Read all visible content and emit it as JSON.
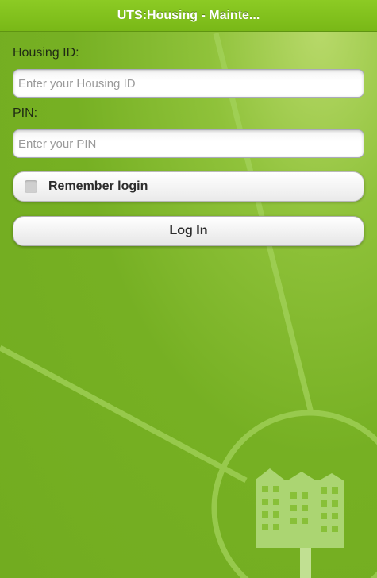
{
  "header": {
    "title": "UTS:Housing - Mainte..."
  },
  "form": {
    "housing_id": {
      "label": "Housing ID:",
      "placeholder": "Enter your Housing ID",
      "value": ""
    },
    "pin": {
      "label": "PIN:",
      "placeholder": "Enter your PIN",
      "value": ""
    },
    "remember": {
      "label": "Remember login",
      "checked": false
    },
    "login_button": {
      "label": "Log In"
    }
  },
  "colors": {
    "background": "#76b023",
    "title_bar": "#85c21f",
    "decor_lines": "#a5d35a"
  },
  "icons": [
    "building-logo-icon"
  ]
}
